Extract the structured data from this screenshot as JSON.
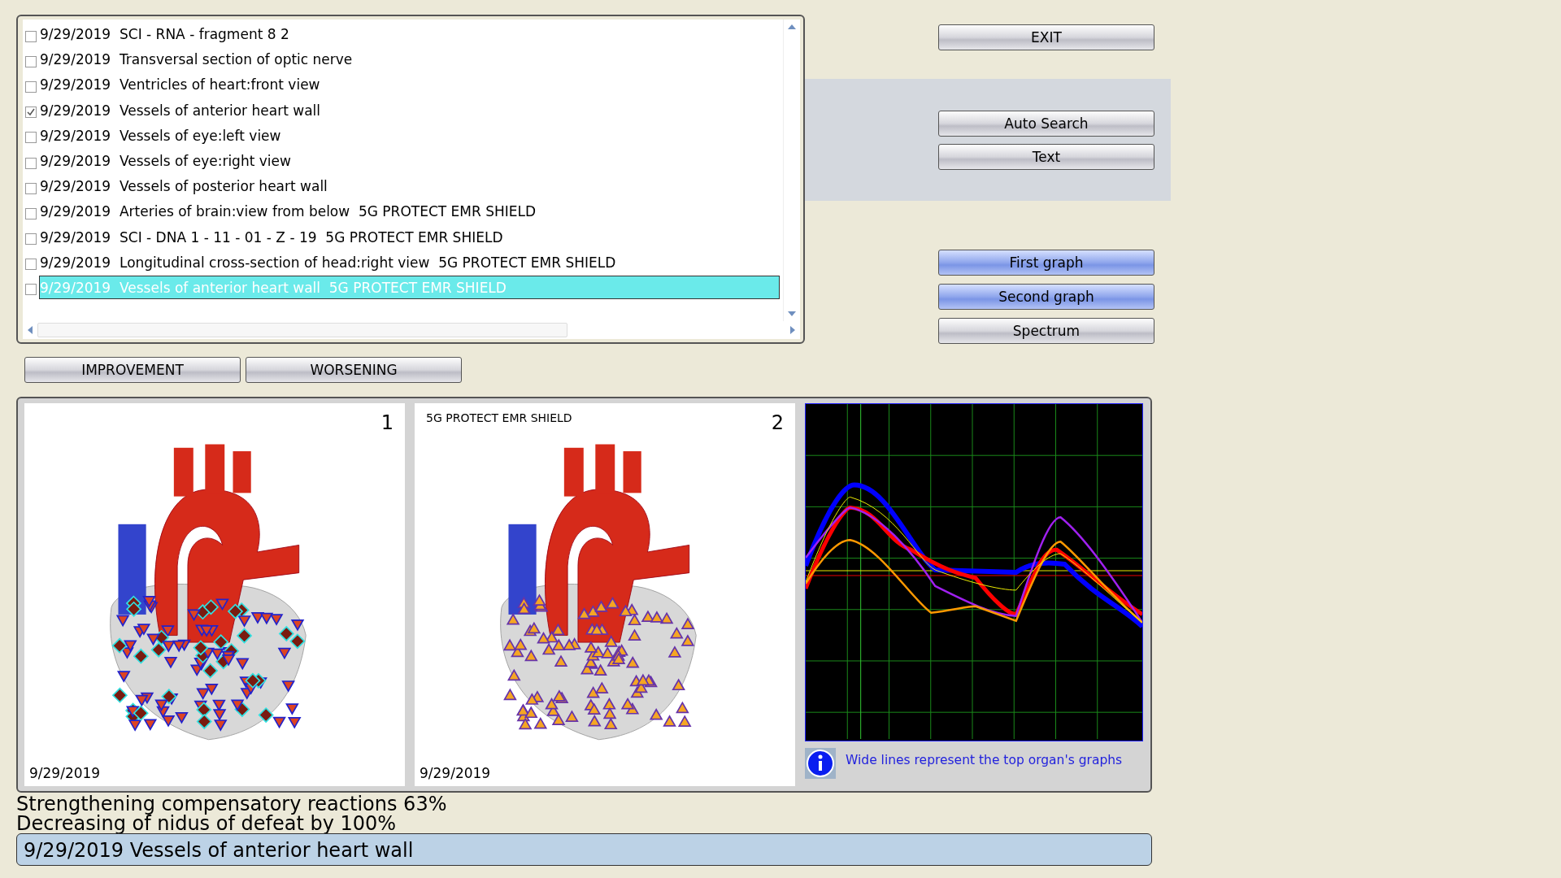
{
  "records": [
    {
      "date": "9/29/2019",
      "title": "SCI - RNA - fragment 8 2",
      "checked": false,
      "selected": false
    },
    {
      "date": "9/29/2019",
      "title": "Transversal section of optic nerve",
      "checked": false,
      "selected": false
    },
    {
      "date": "9/29/2019",
      "title": "Ventricles of heart:front view",
      "checked": false,
      "selected": false
    },
    {
      "date": "9/29/2019",
      "title": "Vessels of anterior heart wall",
      "checked": true,
      "selected": false
    },
    {
      "date": "9/29/2019",
      "title": "Vessels of eye:left view",
      "checked": false,
      "selected": false
    },
    {
      "date": "9/29/2019",
      "title": "Vessels of eye:right view",
      "checked": false,
      "selected": false
    },
    {
      "date": "9/29/2019",
      "title": "Vessels of posterior heart wall",
      "checked": false,
      "selected": false
    },
    {
      "date": "9/29/2019",
      "title": "Arteries of brain:view from below  5G PROTECT EMR SHIELD",
      "checked": false,
      "selected": false
    },
    {
      "date": "9/29/2019",
      "title": "SCI - DNA 1 - 11 - 01 - Z - 19  5G PROTECT EMR SHIELD",
      "checked": false,
      "selected": false
    },
    {
      "date": "9/29/2019",
      "title": "Longitudinal cross-section of head:right view  5G PROTECT EMR SHIELD",
      "checked": false,
      "selected": false
    },
    {
      "date": "9/29/2019",
      "title": "Vessels of anterior heart wall  5G PROTECT EMR SHIELD",
      "checked": false,
      "selected": true
    }
  ],
  "exit_button": "EXIT",
  "tool_buttons": [
    {
      "label": "Auto Search"
    },
    {
      "label": "Text"
    }
  ],
  "graph_buttons": [
    {
      "label": "First graph",
      "selected": true
    },
    {
      "label": "Second graph",
      "selected": true
    },
    {
      "label": "Spectrum",
      "selected": false
    }
  ],
  "compare_buttons": [
    "IMPROVEMENT",
    "WORSENING"
  ],
  "panels": [
    {
      "number": "1",
      "date": "9/29/2019",
      "kind": "before"
    },
    {
      "number": "2",
      "caption": "5G PROTECT EMR SHIELD",
      "date": "9/29/2019",
      "kind": "after"
    }
  ],
  "chart_note": "Wide lines represent the top organ's graphs",
  "results": [
    "Strengthening compensatory reactions 63%",
    "Decreasing of nidus of defeat by 100%"
  ],
  "status_bar": "9/29/2019 Vessels of anterior heart wall"
}
